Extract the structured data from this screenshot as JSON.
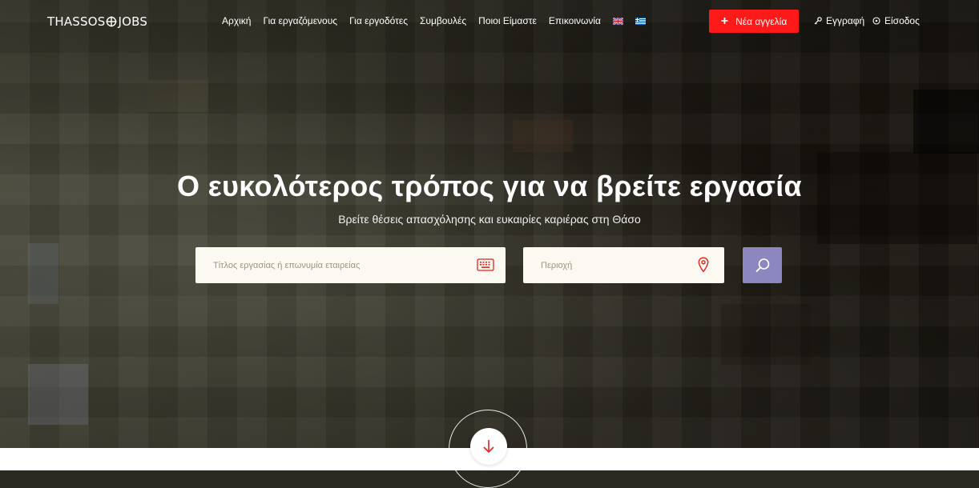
{
  "brand": {
    "logo_left": "THASSOS",
    "logo_right": "JOBS"
  },
  "nav": {
    "items": [
      {
        "label": "Αρχική"
      },
      {
        "label": "Για εργαζόμενους"
      },
      {
        "label": "Για εργοδότες"
      },
      {
        "label": "Συμβουλές"
      },
      {
        "label": "Ποιοι Είμαστε"
      },
      {
        "label": "Επικοινωνία"
      }
    ],
    "languages": [
      "english-flag-icon",
      "greek-flag-icon"
    ]
  },
  "actions": {
    "new_ad_label": "Νέα αγγελία",
    "register_label": "Εγγραφή",
    "login_label": "Είσοδος"
  },
  "hero": {
    "title": "Ο ευκολότερος τρόπος για να βρείτε εργασία",
    "subtitle": "Βρείτε θέσεις απασχόλησης και ευκαιρίες καριέρας στη Θάσο"
  },
  "search": {
    "keyword_placeholder": "Τίτλος εργασίας ή επωνυμία εταιρείας",
    "location_placeholder": "Περιοχή"
  },
  "colors": {
    "accent_red": "#ff1a1a",
    "search_button": "#8c87bf",
    "field_bg": "#fbf9f1"
  }
}
